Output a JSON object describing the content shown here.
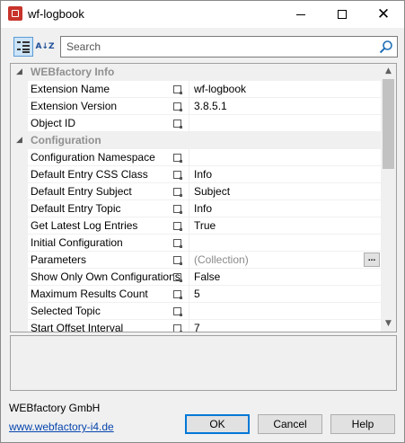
{
  "window": {
    "title": "wf-logbook",
    "minimize_glyph": "",
    "close_glyph": "✕"
  },
  "toolbar": {
    "categorized_icon": "categorized-view-icon",
    "alphabetical_icon": "alphabetical-sort-icon",
    "alphabetical_glyph": "A↓Z",
    "search_placeholder": "Search",
    "search_value": ""
  },
  "grid": {
    "categories": [
      {
        "label": "WEBfactory Info",
        "expanded": true,
        "properties": [
          {
            "name": "Extension Name",
            "value": "wf-logbook"
          },
          {
            "name": "Extension Version",
            "value": "3.8.5.1"
          },
          {
            "name": "Object ID",
            "value": ""
          }
        ]
      },
      {
        "label": "Configuration",
        "expanded": true,
        "properties": [
          {
            "name": "Configuration Namespace",
            "value": ""
          },
          {
            "name": "Default Entry CSS Class",
            "value": "Info"
          },
          {
            "name": "Default Entry Subject",
            "value": "Subject"
          },
          {
            "name": "Default Entry Topic",
            "value": "Info"
          },
          {
            "name": "Get Latest Log Entries",
            "value": "True"
          },
          {
            "name": "Initial Configuration",
            "value": ""
          },
          {
            "name": "Parameters",
            "value": "(Collection)"
          },
          {
            "name": "Show Only Own Configurations",
            "value": "False"
          },
          {
            "name": "Maximum Results Count",
            "value": "5"
          },
          {
            "name": "Selected Topic",
            "value": ""
          },
          {
            "name": "Start Offset Interval",
            "value": "7"
          }
        ]
      }
    ],
    "expander_glyph": "◢",
    "ellipsis_label": "..."
  },
  "scrollbar": {
    "up_glyph": "▲",
    "down_glyph": "▼"
  },
  "footer": {
    "company": "WEBfactory GmbH",
    "website": "www.webfactory-i4.de",
    "ok_label": "OK",
    "cancel_label": "Cancel",
    "help_label": "Help"
  },
  "colors": {
    "accent": "#0078d7",
    "category_text": "#909090",
    "link": "#0645ad",
    "app_icon": "#c8332b"
  }
}
